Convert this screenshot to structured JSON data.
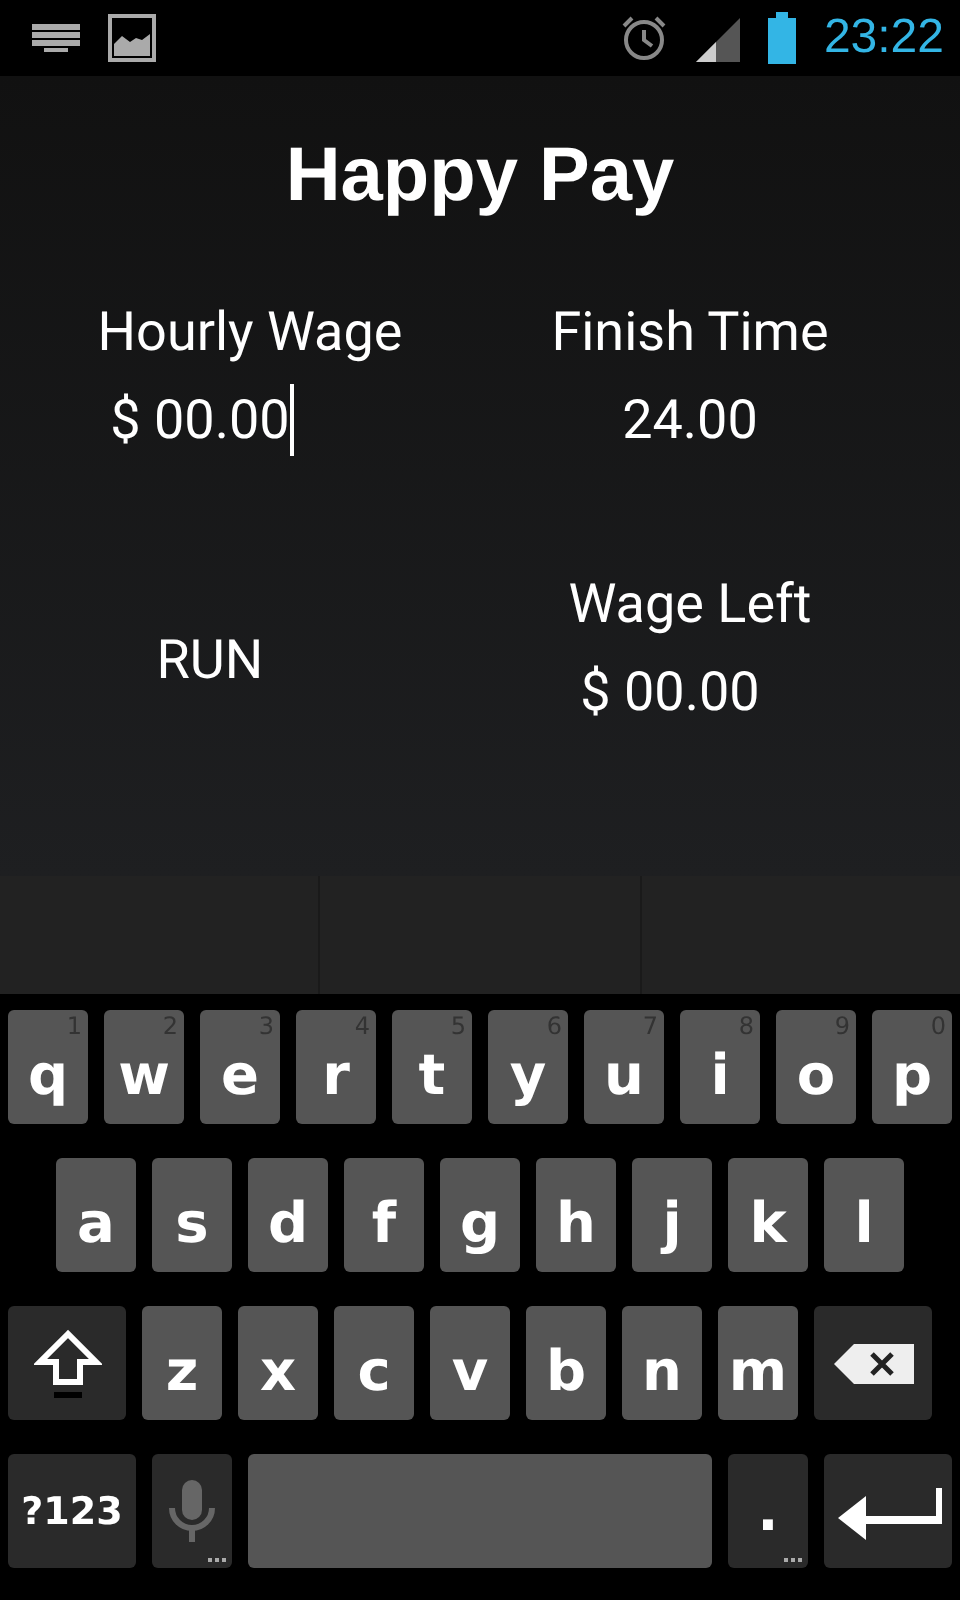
{
  "status_bar": {
    "time": "23:22"
  },
  "app": {
    "title": "Happy Pay",
    "fields": [
      {
        "label": "Hourly Wage",
        "value": "$ 00.00",
        "kind": "input",
        "focused": true
      },
      {
        "label": "Finish Time",
        "value": "24.00",
        "kind": "input",
        "focused": false
      }
    ],
    "run_button": "RUN",
    "result": {
      "label": "Wage Left",
      "value": "$ 00.00"
    }
  },
  "keyboard": {
    "top_row": [
      {
        "kind": "letter",
        "label": "q",
        "hint": "1"
      },
      {
        "kind": "letter",
        "label": "w",
        "hint": "2"
      },
      {
        "kind": "letter",
        "label": "e",
        "hint": "3"
      },
      {
        "kind": "letter",
        "label": "r",
        "hint": "4"
      },
      {
        "kind": "letter",
        "label": "t",
        "hint": "5"
      },
      {
        "kind": "letter",
        "label": "y",
        "hint": "6"
      },
      {
        "kind": "letter",
        "label": "u",
        "hint": "7"
      },
      {
        "kind": "letter",
        "label": "i",
        "hint": "8"
      },
      {
        "kind": "letter",
        "label": "o",
        "hint": "9"
      },
      {
        "kind": "letter",
        "label": "p",
        "hint": "0"
      }
    ],
    "home_row": [
      {
        "kind": "letter",
        "label": "a"
      },
      {
        "kind": "letter",
        "label": "s"
      },
      {
        "kind": "letter",
        "label": "d"
      },
      {
        "kind": "letter",
        "label": "f"
      },
      {
        "kind": "letter",
        "label": "g"
      },
      {
        "kind": "letter",
        "label": "h"
      },
      {
        "kind": "letter",
        "label": "j"
      },
      {
        "kind": "letter",
        "label": "k"
      },
      {
        "kind": "letter",
        "label": "l"
      }
    ],
    "bottom_row": [
      {
        "kind": "shift"
      },
      {
        "kind": "letter",
        "label": "z"
      },
      {
        "kind": "letter",
        "label": "x"
      },
      {
        "kind": "letter",
        "label": "c"
      },
      {
        "kind": "letter",
        "label": "v"
      },
      {
        "kind": "letter",
        "label": "b"
      },
      {
        "kind": "letter",
        "label": "n"
      },
      {
        "kind": "letter",
        "label": "m"
      },
      {
        "kind": "backspace"
      }
    ],
    "function_row": [
      {
        "kind": "symbols",
        "label": "?123"
      },
      {
        "kind": "mic"
      },
      {
        "kind": "space"
      },
      {
        "kind": "period",
        "label": "."
      },
      {
        "kind": "enter"
      }
    ]
  }
}
